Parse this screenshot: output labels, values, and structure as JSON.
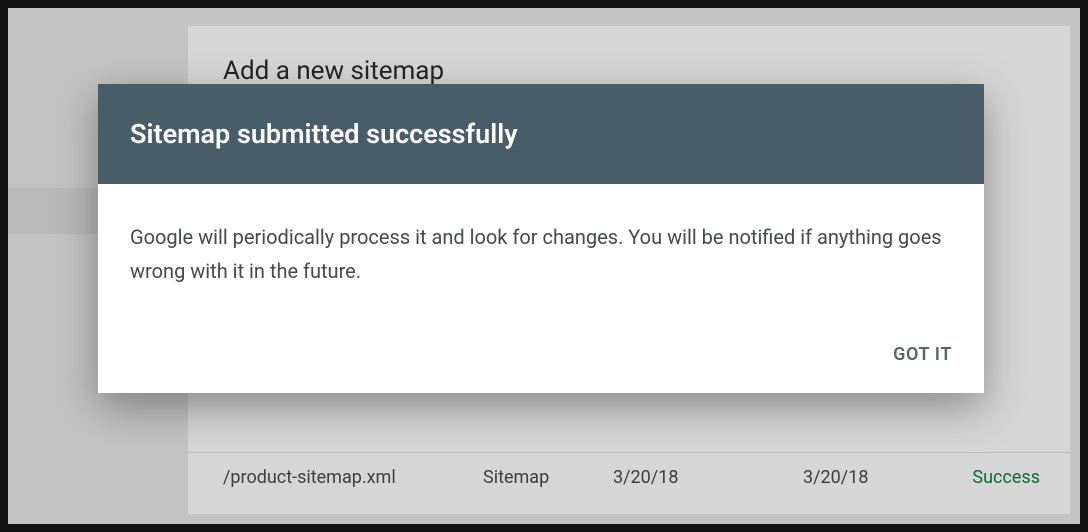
{
  "background": {
    "section_title": "Add a new sitemap",
    "row": {
      "file": "/product-sitemap.xml",
      "type": "Sitemap",
      "date_submitted": "3/20/18",
      "date_read": "3/20/18",
      "status": "Success"
    }
  },
  "dialog": {
    "title": "Sitemap submitted successfully",
    "body": "Google will periodically process it and look for changes. You will be notified if anything goes wrong with it in the future.",
    "confirm_label": "GOT IT"
  }
}
